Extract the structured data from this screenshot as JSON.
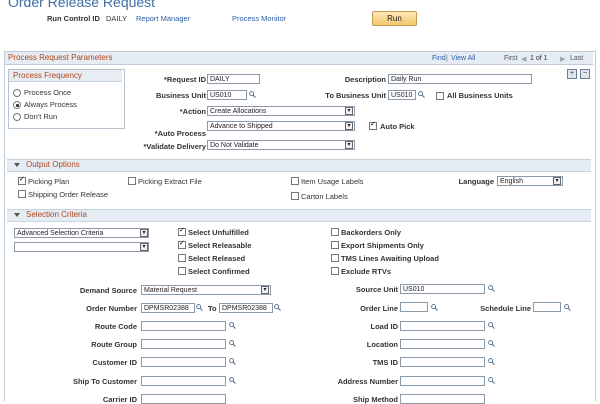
{
  "page": {
    "title": "Order Release Request",
    "run_control_label": "Run Control ID",
    "run_control_value": "DAILY",
    "report_manager": "Report Manager",
    "process_monitor": "Process Monitor",
    "run_button": "Run"
  },
  "params": {
    "title": "Process Request Parameters",
    "find": "Find",
    "view_all": "View All",
    "nav_first": "First",
    "nav_range": "1 of 1",
    "nav_last": "Last",
    "add": "+",
    "remove": "−"
  },
  "frequency": {
    "title": "Process Frequency",
    "options": [
      "Process Once",
      "Always Process",
      "Don't Run"
    ],
    "selected": 1
  },
  "fields": {
    "request_id_label": "*Request ID",
    "request_id": "DAILY",
    "description_label": "Description",
    "description": "Daily Run",
    "business_unit_label": "Business Unit",
    "business_unit": "US010",
    "to_business_unit_label": "To Business Unit",
    "to_business_unit": "US010",
    "all_business_units": "All Business Units",
    "action_label": "*Action",
    "action": "Create Allocations",
    "auto_process_label": "*Auto Process",
    "auto_process": "Advance to Shipped",
    "auto_pick": "Auto Pick",
    "validate_delivery_label": "*Validate Delivery",
    "validate_delivery": "Do Not Validate"
  },
  "output": {
    "title": "Output Options",
    "picking_plan": "Picking Plan",
    "picking_extract_file": "Picking Extract File",
    "item_usage_labels": "Item Usage Labels",
    "language_label": "Language",
    "language": "English",
    "shipping_order_release": "Shipping Order Release",
    "carton_labels": "Carton Labels"
  },
  "selection": {
    "title": "Selection Criteria",
    "criteria_select": "Advanced Selection Criteria",
    "select_unfulfilled": "Select Unfulfilled",
    "select_releasable": "Select Releasable",
    "select_released": "Select Released",
    "select_confirmed": "Select Confirmed",
    "backorders_only": "Backorders Only",
    "export_shipments_only": "Export Shipments Only",
    "tms_lines_awaiting_upload": "TMS Lines Awaiting Upload",
    "exclude_rtvs": "Exclude RTVs",
    "demand_source_label": "Demand Source",
    "demand_source": "Material Request",
    "source_unit_label": "Source Unit",
    "source_unit": "US010",
    "order_number_label": "Order Number",
    "order_number_from": "DPMSR02388",
    "to_label": "To",
    "order_number_to": "DPMSR02388",
    "order_line_label": "Order Line",
    "schedule_line_label": "Schedule Line",
    "route_code_label": "Route Code",
    "load_id_label": "Load ID",
    "route_group_label": "Route Group",
    "location_label": "Location",
    "customer_id_label": "Customer ID",
    "tms_id_label": "TMS ID",
    "ship_to_customer_label": "Ship To Customer",
    "address_number_label": "Address Number",
    "carrier_id_label": "Carrier ID",
    "ship_method_label": "Ship Method"
  },
  "colors": {
    "section_title": "#b0471d",
    "link": "#2a5da8",
    "header_bg": "#e6ecf4"
  }
}
